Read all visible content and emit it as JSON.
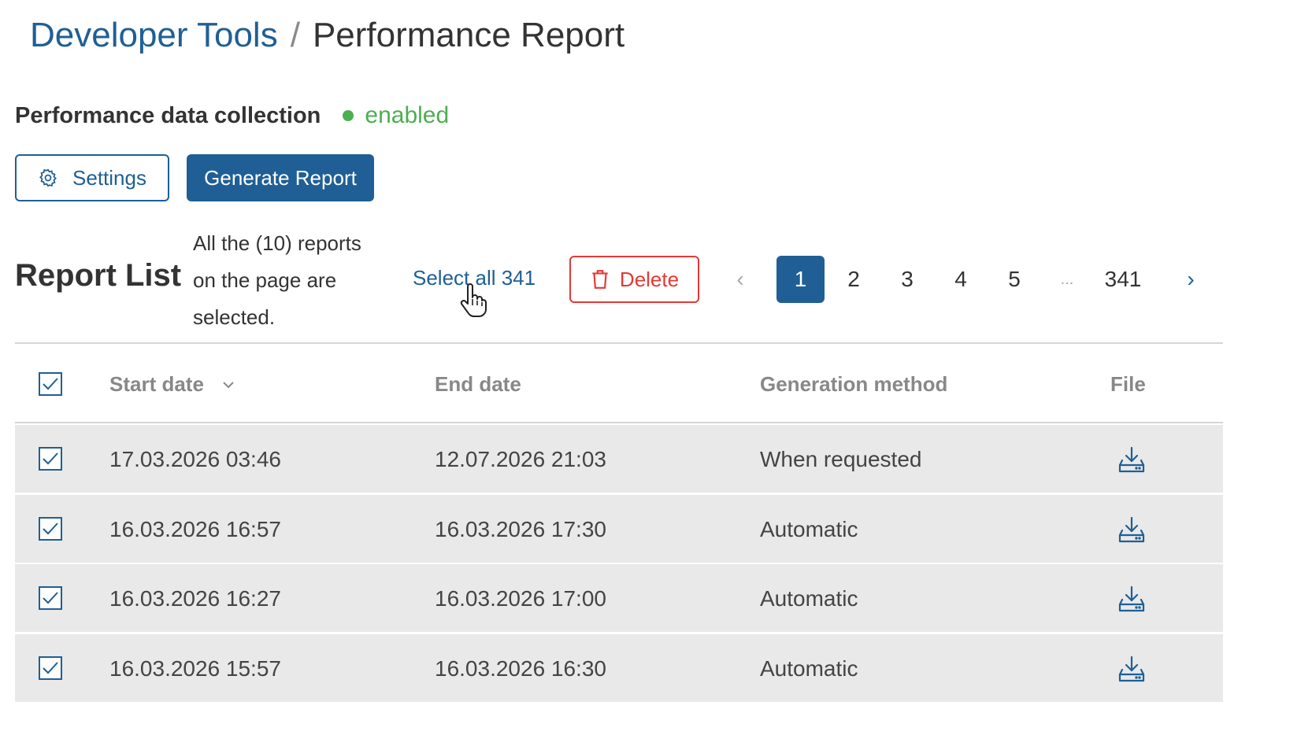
{
  "breadcrumb": {
    "parent": "Developer Tools",
    "separator": "/",
    "current": "Performance Report"
  },
  "collection": {
    "label": "Performance data collection",
    "status": "enabled",
    "status_color": "#4caf50"
  },
  "buttons": {
    "settings": "Settings",
    "generate": "Generate Report",
    "delete": "Delete"
  },
  "report_list": {
    "title": "Report List",
    "selected_info": "All the (10) reports on the page are selected.",
    "select_all": "Select all 341"
  },
  "pagination": {
    "prev": "‹",
    "pages": [
      "1",
      "2",
      "3",
      "4",
      "5"
    ],
    "ellipsis": "...",
    "last": "341",
    "next": "›",
    "current": "1"
  },
  "table": {
    "columns": {
      "start_date": "Start date",
      "end_date": "End date",
      "method": "Generation method",
      "file": "File"
    },
    "rows": [
      {
        "start": "17.03.2026 03:46",
        "end": "12.07.2026 21:03",
        "method": "When requested",
        "checked": true
      },
      {
        "start": "16.03.2026 16:57",
        "end": "16.03.2026 17:30",
        "method": "Automatic",
        "checked": true
      },
      {
        "start": "16.03.2026 16:27",
        "end": "16.03.2026 17:00",
        "method": "Automatic",
        "checked": true
      },
      {
        "start": "16.03.2026 15:57",
        "end": "16.03.2026 16:30",
        "method": "Automatic",
        "checked": true
      }
    ]
  },
  "colors": {
    "primary": "#1f5f95",
    "danger": "#e53935",
    "row_bg": "#e9e9e9"
  },
  "icons": {
    "settings": "gear-icon",
    "delete": "trash-icon",
    "download": "download-icon",
    "sort": "chevron-down-icon",
    "cursor": "hand-pointer-icon"
  }
}
